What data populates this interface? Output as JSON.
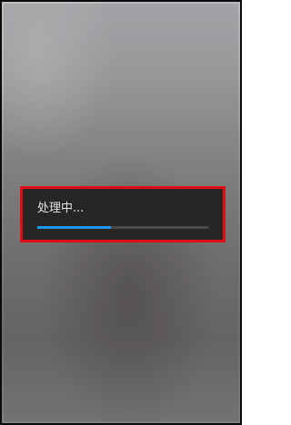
{
  "dialog": {
    "message": "处理中...",
    "progress": 0.43,
    "highlight_color": "#e30c17",
    "progress_color": "#2196e8"
  }
}
